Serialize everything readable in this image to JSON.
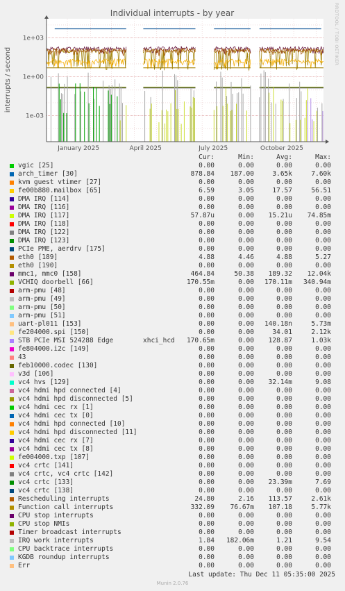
{
  "chart_data": {
    "type": "line",
    "title": "Individual interrupts - by year",
    "ylabel": "interrupts / second",
    "yscale": "log",
    "ylim": [
      1e-05,
      30000
    ],
    "y_ticks": [
      "1e+03",
      "1e+00",
      "1e-03"
    ],
    "y_tick_values": [
      1000,
      1,
      0.001
    ],
    "x_range": [
      "2024-12-04",
      "2025-12-11"
    ],
    "x_ticks": [
      "January 2025",
      "April 2025",
      "July 2025",
      "October 2025"
    ],
    "x_tick_dates": [
      "2025-01-01",
      "2025-04-01",
      "2025-07-01",
      "2025-10-01"
    ],
    "grid": true,
    "gaps": [
      [
        "2025-03-22",
        "2025-04-12"
      ],
      [
        "2025-06-23",
        "2025-07-16"
      ],
      [
        "2025-09-05",
        "2025-09-15"
      ]
    ],
    "series": [
      {
        "name": "arch_timer [30]",
        "color": "#135898",
        "style": "flat",
        "level": 5000,
        "start": "2024-12-15",
        "until": "2025-12-08"
      },
      {
        "name": "Function call interrupts",
        "color": "#9f7f00",
        "style": "noisy",
        "level": 100,
        "low": 3,
        "start": "2024-12-04",
        "until": "2025-12-11"
      },
      {
        "name": "mmc1, mmc0 [158]",
        "color": "#6a1a3f",
        "style": "noisy",
        "level": 150,
        "low": 60,
        "start": "2024-12-04",
        "until": "2025-12-11"
      },
      {
        "name": "Rescheduling interrupts",
        "color": "#a9590f",
        "style": "noisy",
        "level": 110,
        "low": 40,
        "start": "2024-12-04",
        "until": "2025-12-11"
      },
      {
        "name": "fe00b880.mailbox [65]",
        "color": "#f5b10c",
        "style": "noisy",
        "level": 17,
        "low": 4,
        "start": "2024-12-04",
        "until": "2025-12-11"
      },
      {
        "name": "eth0 [189]",
        "color": "#a07e00",
        "style": "flat",
        "level": 4.9,
        "start": "2024-12-04",
        "until": "2025-12-11"
      },
      {
        "name": "VCHIQ doorbell [66]",
        "color": "#8fa31c",
        "style": "flat",
        "level": 0.16,
        "start": "2024-12-04",
        "until": "2025-12-11"
      },
      {
        "name": "STB PCIe MSI 524288 Edge xhci_hcd",
        "color": "#555555",
        "style": "flat",
        "level": 0.14,
        "start": "2024-12-04",
        "until": "2025-12-11"
      },
      {
        "name": "IRQ work interrupts",
        "color": "#a8a8a8",
        "style": "spikes",
        "level": 0.5,
        "start": "2024-12-04",
        "until": "2025-12-11"
      },
      {
        "name": "vc4 crtc [133]",
        "color": "#00a000",
        "style": "spikes",
        "level": 0.05,
        "start": "2024-12-15",
        "until": "2025-03-15"
      },
      {
        "name": "DMA IRQ [117]",
        "color": "#ccdd33",
        "style": "spikes",
        "level": 0.02,
        "start": "2025-03-01",
        "until": "2025-12-11"
      },
      {
        "name": "vc4 hvs [129]",
        "color": "#b48fe8",
        "style": "spikes",
        "level": 0.01,
        "start": "2025-11-20",
        "until": "2025-12-11"
      }
    ]
  },
  "legend": {
    "columns": [
      "Cur:",
      "Min:",
      "Avg:",
      "Max:"
    ],
    "rows": [
      {
        "name": "vgic [25]",
        "color": "#00cc00",
        "cur": "0.00",
        "min": "0.00",
        "avg": "0.00",
        "max": "0.00"
      },
      {
        "name": "arch_timer [30]",
        "color": "#0066b3",
        "cur": "878.84",
        "min": "187.00",
        "avg": "3.65k",
        "max": "7.60k"
      },
      {
        "name": "kvm guest vtimer [27]",
        "color": "#ff8000",
        "cur": "0.00",
        "min": "0.00",
        "avg": "0.00",
        "max": "0.00"
      },
      {
        "name": "fe00b880.mailbox [65]",
        "color": "#ffcc00",
        "cur": "6.59",
        "min": "3.05",
        "avg": "17.57",
        "max": "56.51"
      },
      {
        "name": "DMA IRQ [114]",
        "color": "#330099",
        "cur": "0.00",
        "min": "0.00",
        "avg": "0.00",
        "max": "0.00"
      },
      {
        "name": "DMA IRQ [116]",
        "color": "#990099",
        "cur": "0.00",
        "min": "0.00",
        "avg": "0.00",
        "max": "0.00"
      },
      {
        "name": "DMA IRQ [117]",
        "color": "#ccff00",
        "cur": "57.87u",
        "min": "0.00",
        "avg": "15.21u",
        "max": "74.85m"
      },
      {
        "name": "DMA IRQ [118]",
        "color": "#ff0000",
        "cur": "0.00",
        "min": "0.00",
        "avg": "0.00",
        "max": "0.00"
      },
      {
        "name": "DMA IRQ [122]",
        "color": "#808080",
        "cur": "0.00",
        "min": "0.00",
        "avg": "0.00",
        "max": "0.00"
      },
      {
        "name": "DMA IRQ [123]",
        "color": "#008f00",
        "cur": "0.00",
        "min": "0.00",
        "avg": "0.00",
        "max": "0.00"
      },
      {
        "name": "PCIe PME, aerdrv [175]",
        "color": "#00487d",
        "cur": "0.00",
        "min": "0.00",
        "avg": "0.00",
        "max": "0.00"
      },
      {
        "name": "eth0 [189]",
        "color": "#b35a00",
        "cur": "4.88",
        "min": "4.46",
        "avg": "4.88",
        "max": "5.27"
      },
      {
        "name": "eth0 [190]",
        "color": "#b38f00",
        "cur": "0.00",
        "min": "0.00",
        "avg": "0.00",
        "max": "0.00"
      },
      {
        "name": "mmc1, mmc0 [158]",
        "color": "#6b006b",
        "cur": "464.84",
        "min": "50.38",
        "avg": "189.32",
        "max": "12.04k"
      },
      {
        "name": "VCHIQ doorbell [66]",
        "color": "#8fb300",
        "cur": "170.55m",
        "min": "0.00",
        "avg": "170.11m",
        "max": "340.94m"
      },
      {
        "name": "arm-pmu [48]",
        "color": "#b30000",
        "cur": "0.00",
        "min": "0.00",
        "avg": "0.00",
        "max": "0.00"
      },
      {
        "name": "arm-pmu [49]",
        "color": "#bebebe",
        "cur": "0.00",
        "min": "0.00",
        "avg": "0.00",
        "max": "0.00"
      },
      {
        "name": "arm-pmu [50]",
        "color": "#80ff80",
        "cur": "0.00",
        "min": "0.00",
        "avg": "0.00",
        "max": "0.00"
      },
      {
        "name": "arm-pmu [51]",
        "color": "#80c9ff",
        "cur": "0.00",
        "min": "0.00",
        "avg": "0.00",
        "max": "0.00"
      },
      {
        "name": "uart-pl011 [153]",
        "color": "#ffc080",
        "cur": "0.00",
        "min": "0.00",
        "avg": "140.18n",
        "max": "5.73m"
      },
      {
        "name": "fe204000.spi [150]",
        "color": "#ffe680",
        "cur": "0.00",
        "min": "0.00",
        "avg": "34.01",
        "max": "2.12k"
      },
      {
        "name": "STB PCIe MSI 524288 Edge",
        "name2": "xhci_hcd",
        "color": "#aa80ff",
        "cur": "170.65m",
        "min": "0.00",
        "avg": "128.87",
        "max": "1.03k"
      },
      {
        "name": "fe804000.i2c [149]",
        "color": "#ee00cc",
        "cur": "0.00",
        "min": "0.00",
        "avg": "0.00",
        "max": "0.00"
      },
      {
        "name": "43",
        "color": "#ff8080",
        "cur": "0.00",
        "min": "0.00",
        "avg": "0.00",
        "max": "0.00"
      },
      {
        "name": "feb10000.codec [130]",
        "color": "#666600",
        "cur": "0.00",
        "min": "0.00",
        "avg": "0.00",
        "max": "0.00"
      },
      {
        "name": "v3d [106]",
        "color": "#ffbfff",
        "cur": "0.00",
        "min": "0.00",
        "avg": "0.00",
        "max": "0.00"
      },
      {
        "name": "vc4 hvs [129]",
        "color": "#00ffcc",
        "cur": "0.00",
        "min": "0.00",
        "avg": "32.14m",
        "max": "9.08"
      },
      {
        "name": "vc4 hdmi hpd connected [4]",
        "color": "#cc6699",
        "cur": "0.00",
        "min": "0.00",
        "avg": "0.00",
        "max": "0.00"
      },
      {
        "name": "vc4 hdmi hpd disconnected [5]",
        "color": "#999900",
        "cur": "0.00",
        "min": "0.00",
        "avg": "0.00",
        "max": "0.00"
      },
      {
        "name": "vc4 hdmi cec rx [1]",
        "color": "#00cc00",
        "cur": "0.00",
        "min": "0.00",
        "avg": "0.00",
        "max": "0.00"
      },
      {
        "name": "vc4 hdmi cec tx [0]",
        "color": "#0066b3",
        "cur": "0.00",
        "min": "0.00",
        "avg": "0.00",
        "max": "0.00"
      },
      {
        "name": "vc4 hdmi hpd connected [10]",
        "color": "#ff8000",
        "cur": "0.00",
        "min": "0.00",
        "avg": "0.00",
        "max": "0.00"
      },
      {
        "name": "vc4 hdmi hpd disconnected [11]",
        "color": "#ffcc00",
        "cur": "0.00",
        "min": "0.00",
        "avg": "0.00",
        "max": "0.00"
      },
      {
        "name": "vc4 hdmi cec rx [7]",
        "color": "#330099",
        "cur": "0.00",
        "min": "0.00",
        "avg": "0.00",
        "max": "0.00"
      },
      {
        "name": "vc4 hdmi cec tx [8]",
        "color": "#990099",
        "cur": "0.00",
        "min": "0.00",
        "avg": "0.00",
        "max": "0.00"
      },
      {
        "name": "fe004000.txp [107]",
        "color": "#ccff00",
        "cur": "0.00",
        "min": "0.00",
        "avg": "0.00",
        "max": "0.00"
      },
      {
        "name": "vc4 crtc [141]",
        "color": "#ff0000",
        "cur": "0.00",
        "min": "0.00",
        "avg": "0.00",
        "max": "0.00"
      },
      {
        "name": "vc4 crtc, vc4 crtc [142]",
        "color": "#808080",
        "cur": "0.00",
        "min": "0.00",
        "avg": "0.00",
        "max": "0.00"
      },
      {
        "name": "vc4 crtc [133]",
        "color": "#008f00",
        "cur": "0.00",
        "min": "0.00",
        "avg": "23.39m",
        "max": "7.69"
      },
      {
        "name": "vc4 crtc [138]",
        "color": "#00487d",
        "cur": "0.00",
        "min": "0.00",
        "avg": "0.00",
        "max": "0.00"
      },
      {
        "name": "Rescheduling interrupts",
        "color": "#b35a00",
        "cur": "24.80",
        "min": "2.16",
        "avg": "113.57",
        "max": "2.61k"
      },
      {
        "name": "Function call interrupts",
        "color": "#b38f00",
        "cur": "332.09",
        "min": "76.67m",
        "avg": "107.18",
        "max": "5.77k"
      },
      {
        "name": "CPU stop interrupts",
        "color": "#6b006b",
        "cur": "0.00",
        "min": "0.00",
        "avg": "0.00",
        "max": "0.00"
      },
      {
        "name": "CPU stop NMIs",
        "color": "#8fb300",
        "cur": "0.00",
        "min": "0.00",
        "avg": "0.00",
        "max": "0.00"
      },
      {
        "name": "Timer broadcast interrupts",
        "color": "#b30000",
        "cur": "0.00",
        "min": "0.00",
        "avg": "0.00",
        "max": "0.00"
      },
      {
        "name": "IRQ work interrupts",
        "color": "#bebebe",
        "cur": "1.84",
        "min": "182.06m",
        "avg": "1.21",
        "max": "9.54"
      },
      {
        "name": "CPU backtrace interrupts",
        "color": "#80ff80",
        "cur": "0.00",
        "min": "0.00",
        "avg": "0.00",
        "max": "0.00"
      },
      {
        "name": "KGDB roundup interrupts",
        "color": "#80c9ff",
        "cur": "0.00",
        "min": "0.00",
        "avg": "0.00",
        "max": "0.00"
      },
      {
        "name": "Err",
        "color": "#ffc080",
        "cur": "0.00",
        "min": "0.00",
        "avg": "0.00",
        "max": "0.00"
      }
    ]
  },
  "last_update": "Last update: Thu Dec 11 05:35:00 2025",
  "footer": "Munin 2.0.76",
  "side_credit": "RRDTOOL / TOBI OETIKER"
}
